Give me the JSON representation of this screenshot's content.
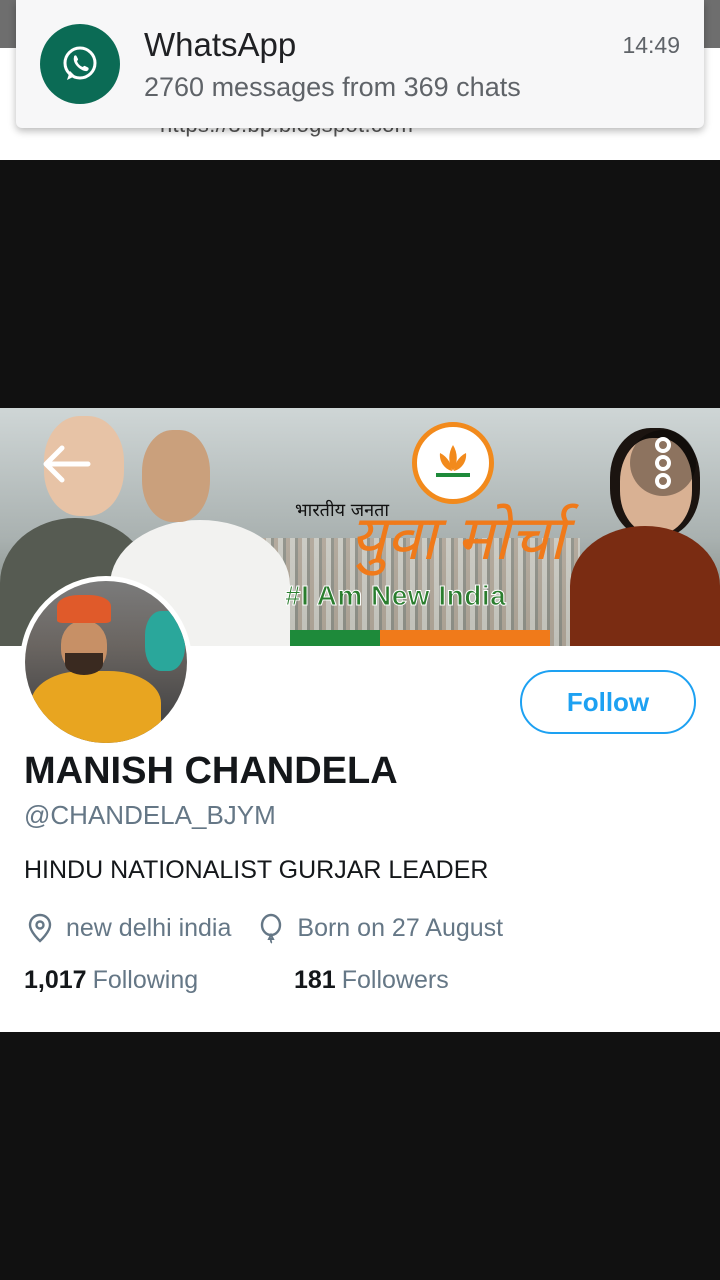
{
  "notification": {
    "app_name": "WhatsApp",
    "time": "14:49",
    "message": "2760 messages from 369 chats",
    "icon": "whatsapp-icon",
    "icon_color": "#0b6b55"
  },
  "browser": {
    "url_partial": "https://3.bp.blogspot.com"
  },
  "banner": {
    "hindi_small": "भारतीय जनता",
    "hindi_big": "युवा मोर्चा",
    "slogan": "#I Am New India"
  },
  "nav": {
    "back_icon": "arrow-left-icon",
    "more_icon": "more-vertical-icon"
  },
  "profile": {
    "name": "MANISH CHANDELA",
    "handle": "@CHANDELA_BJYM",
    "bio": "HINDU NATIONALIST GURJAR LEADER",
    "location": "new delhi india",
    "birthday": "Born on 27 August",
    "following_count": "1,017",
    "following_label": "Following",
    "followers_count": "181",
    "followers_label": "Followers",
    "follow_button": "Follow",
    "accent_color": "#1da1f2"
  }
}
